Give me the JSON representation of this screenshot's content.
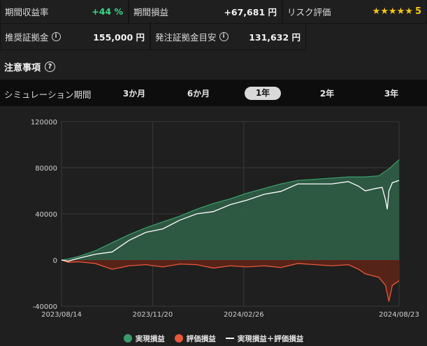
{
  "stats": {
    "period_return_label": "期間収益率",
    "period_return_value": "+44 %",
    "period_pl_label": "期間損益",
    "period_pl_value": "+67,681 円",
    "risk_label": "リスク評価",
    "risk_stars": "★★★★★",
    "risk_value": "5",
    "rec_margin_label": "推奨証拠金",
    "rec_margin_value": "155,000 円",
    "order_margin_label": "発注証拠金目安",
    "order_margin_value": "131,632 円"
  },
  "notice": {
    "label": "注意事項"
  },
  "period": {
    "label": "シミュレーション期間",
    "tabs": [
      "3か月",
      "6か月",
      "1年",
      "2年",
      "3年"
    ],
    "active_index": 2
  },
  "colors": {
    "realized": "#3a9a6b",
    "unrealized": "#e8583a",
    "total": "#ffffff",
    "positive": "#39d98a",
    "star": "#f5c518"
  },
  "legend": {
    "realized": "実現損益",
    "unrealized": "評価損益",
    "total": "実現損益＋評価損益"
  },
  "chart_data": {
    "type": "area",
    "ylim": [
      -40000,
      120000
    ],
    "yticks": [
      "120000",
      "80000",
      "40000",
      "0",
      "-40000"
    ],
    "xtick_labels": [
      "2023/08/14",
      "2023/11/20",
      "2024/02/26",
      "2024/08/23"
    ],
    "grid": true,
    "series": [
      {
        "name": "実現損益",
        "x": [
          0,
          0.02,
          0.05,
          0.1,
          0.15,
          0.2,
          0.25,
          0.3,
          0.35,
          0.4,
          0.45,
          0.5,
          0.55,
          0.6,
          0.65,
          0.7,
          0.75,
          0.8,
          0.85,
          0.9,
          0.94,
          0.97,
          1.0
        ],
        "values": [
          0,
          1000,
          3000,
          8000,
          15000,
          22000,
          28000,
          33000,
          38000,
          44000,
          49000,
          53000,
          58000,
          62000,
          66000,
          69000,
          70000,
          71000,
          72000,
          72000,
          73000,
          79000,
          87000
        ]
      },
      {
        "name": "評価損益",
        "x": [
          0,
          0.02,
          0.05,
          0.1,
          0.15,
          0.2,
          0.25,
          0.3,
          0.35,
          0.4,
          0.45,
          0.5,
          0.55,
          0.6,
          0.65,
          0.7,
          0.75,
          0.8,
          0.85,
          0.88,
          0.9,
          0.94,
          0.96,
          0.97,
          0.98,
          1.0
        ],
        "values": [
          0,
          -2000,
          -1500,
          -3000,
          -8000,
          -5000,
          -4000,
          -6000,
          -3500,
          -4000,
          -7000,
          -5000,
          -6000,
          -5000,
          -6500,
          -3000,
          -4000,
          -5000,
          -4000,
          -8000,
          -12000,
          -15000,
          -22000,
          -36000,
          -22000,
          -18000
        ]
      },
      {
        "name": "実現損益＋評価損益",
        "x": [
          0,
          0.02,
          0.05,
          0.1,
          0.15,
          0.2,
          0.25,
          0.3,
          0.35,
          0.4,
          0.45,
          0.5,
          0.55,
          0.6,
          0.65,
          0.7,
          0.75,
          0.8,
          0.85,
          0.88,
          0.9,
          0.93,
          0.95,
          0.96,
          0.965,
          0.97,
          0.98,
          1.0
        ],
        "values": [
          0,
          -1000,
          1500,
          5000,
          7000,
          17000,
          24000,
          27000,
          34500,
          40000,
          42000,
          48000,
          52000,
          57000,
          59500,
          66000,
          66000,
          66000,
          68000,
          64000,
          60000,
          62000,
          63000,
          52000,
          44000,
          60000,
          67000,
          69000
        ]
      }
    ]
  }
}
